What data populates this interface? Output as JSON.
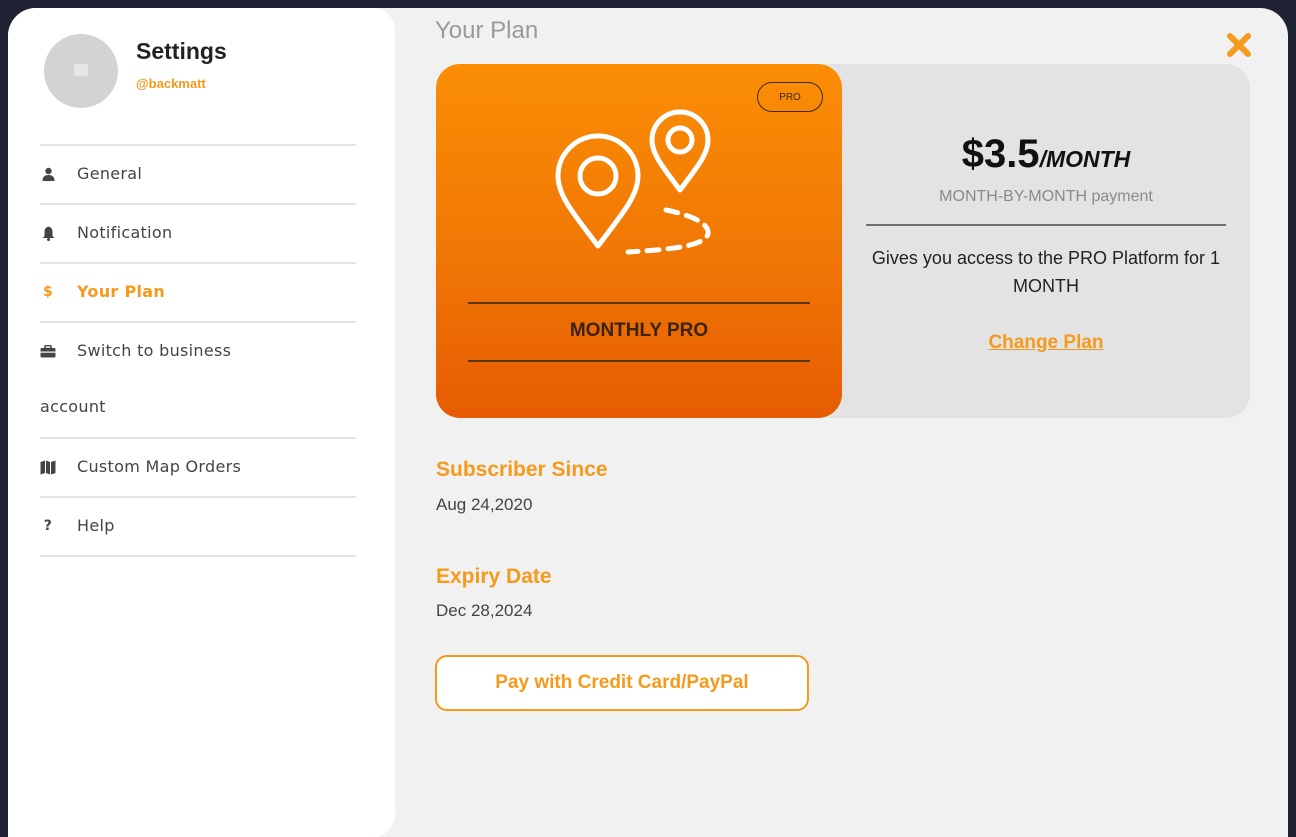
{
  "sidebar": {
    "title": "Settings",
    "username": "@backmatt",
    "items": [
      {
        "label": "General",
        "icon": "user-icon"
      },
      {
        "label": "Notification",
        "icon": "bell-icon"
      },
      {
        "label": "Your Plan",
        "icon": "dollar-icon",
        "glyph": "$",
        "active": true
      },
      {
        "label": "Switch to business",
        "label_line2": "account",
        "icon": "briefcase-icon"
      },
      {
        "label": "Custom Map Orders",
        "icon": "map-icon"
      },
      {
        "label": "Help",
        "icon": "question-icon",
        "glyph": "?"
      }
    ]
  },
  "main": {
    "title": "Your Plan",
    "plan": {
      "badge": "PRO",
      "name": "MONTHLY PRO",
      "price": "$3.5",
      "period": "/MONTH",
      "payment_type": "MONTH-BY-MONTH payment",
      "description": "Gives you access to the PRO Platform for 1 MONTH",
      "change_link": "Change Plan"
    },
    "subscriber_since": {
      "label": "Subscriber Since",
      "value": "Aug 24,2020"
    },
    "expiry_date": {
      "label": "Expiry Date",
      "value": "Dec 28,2024"
    },
    "pay_button": "Pay with Credit Card/PayPal"
  },
  "colors": {
    "accent": "#f59a1b",
    "card_gradient_top": "#fb8e05",
    "card_gradient_bottom": "#e75c03",
    "background": "#f1f1f1",
    "frame": "#1f2233"
  }
}
